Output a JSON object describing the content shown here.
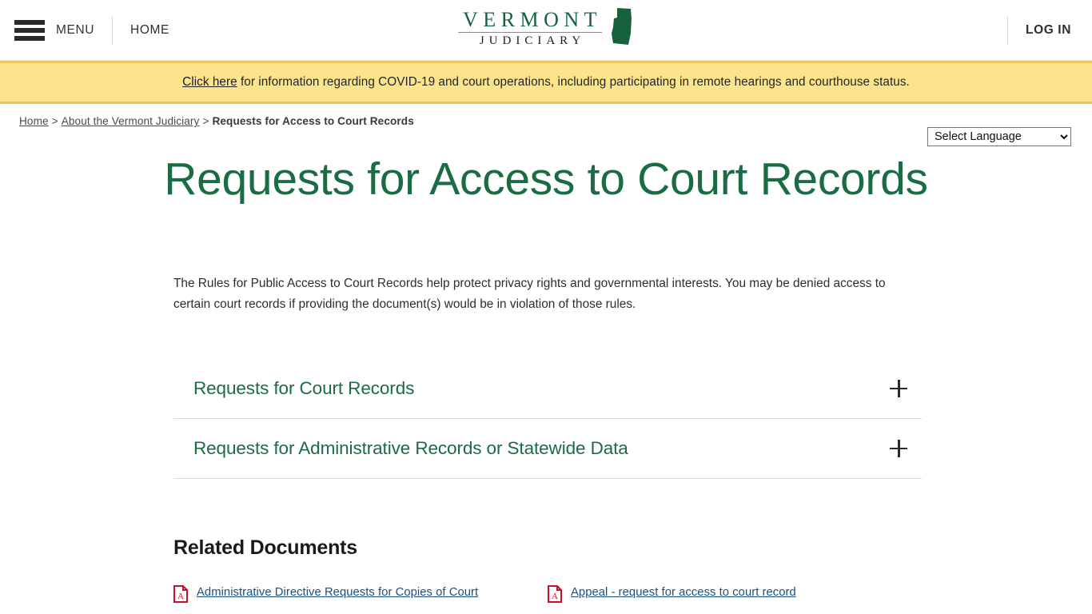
{
  "header": {
    "menu_label": "MENU",
    "home_label": "HOME",
    "login_label": "LOG IN",
    "logo": {
      "line1": "VERMONT",
      "line2": "JUDICIARY",
      "state_shape": "vermont-state-icon",
      "color": "#17613e"
    },
    "hamburger_icon": "hamburger-menu-icon"
  },
  "alert": {
    "link_text": "Click here",
    "message": " for information regarding COVID-19 and court operations, including participating in remote hearings and courthouse status.",
    "background": "#fbe48b",
    "border_color": "#e8c85a"
  },
  "breadcrumb": {
    "items": [
      {
        "label": "Home",
        "current": false
      },
      {
        "label": "About the Vermont Judiciary",
        "current": false
      },
      {
        "label": "Requests for Access to Court Records",
        "current": true
      }
    ],
    "separator": ">"
  },
  "language": {
    "selected": "Select Language",
    "options": [
      "Select Language"
    ]
  },
  "main": {
    "title": "Requests for Access to Court Records",
    "title_color": "#1b6b43",
    "intro": "The Rules for Public Access to Court Records help protect privacy rights and governmental interests. You may be denied access to certain court records if providing the document(s) would be in violation of those rules.",
    "accordion": [
      {
        "title": "Requests for Court Records",
        "expand_icon": "plus-icon"
      },
      {
        "title": "Requests for Administrative Records or Statewide Data",
        "expand_icon": "plus-icon"
      }
    ],
    "related_documents": {
      "heading": "Related Documents",
      "items": [
        {
          "label": "Administrative Directive Requests for Copies of Court",
          "icon": "pdf-icon"
        },
        {
          "label": "Appeal - request for access to court record",
          "icon": "pdf-icon"
        }
      ]
    }
  }
}
